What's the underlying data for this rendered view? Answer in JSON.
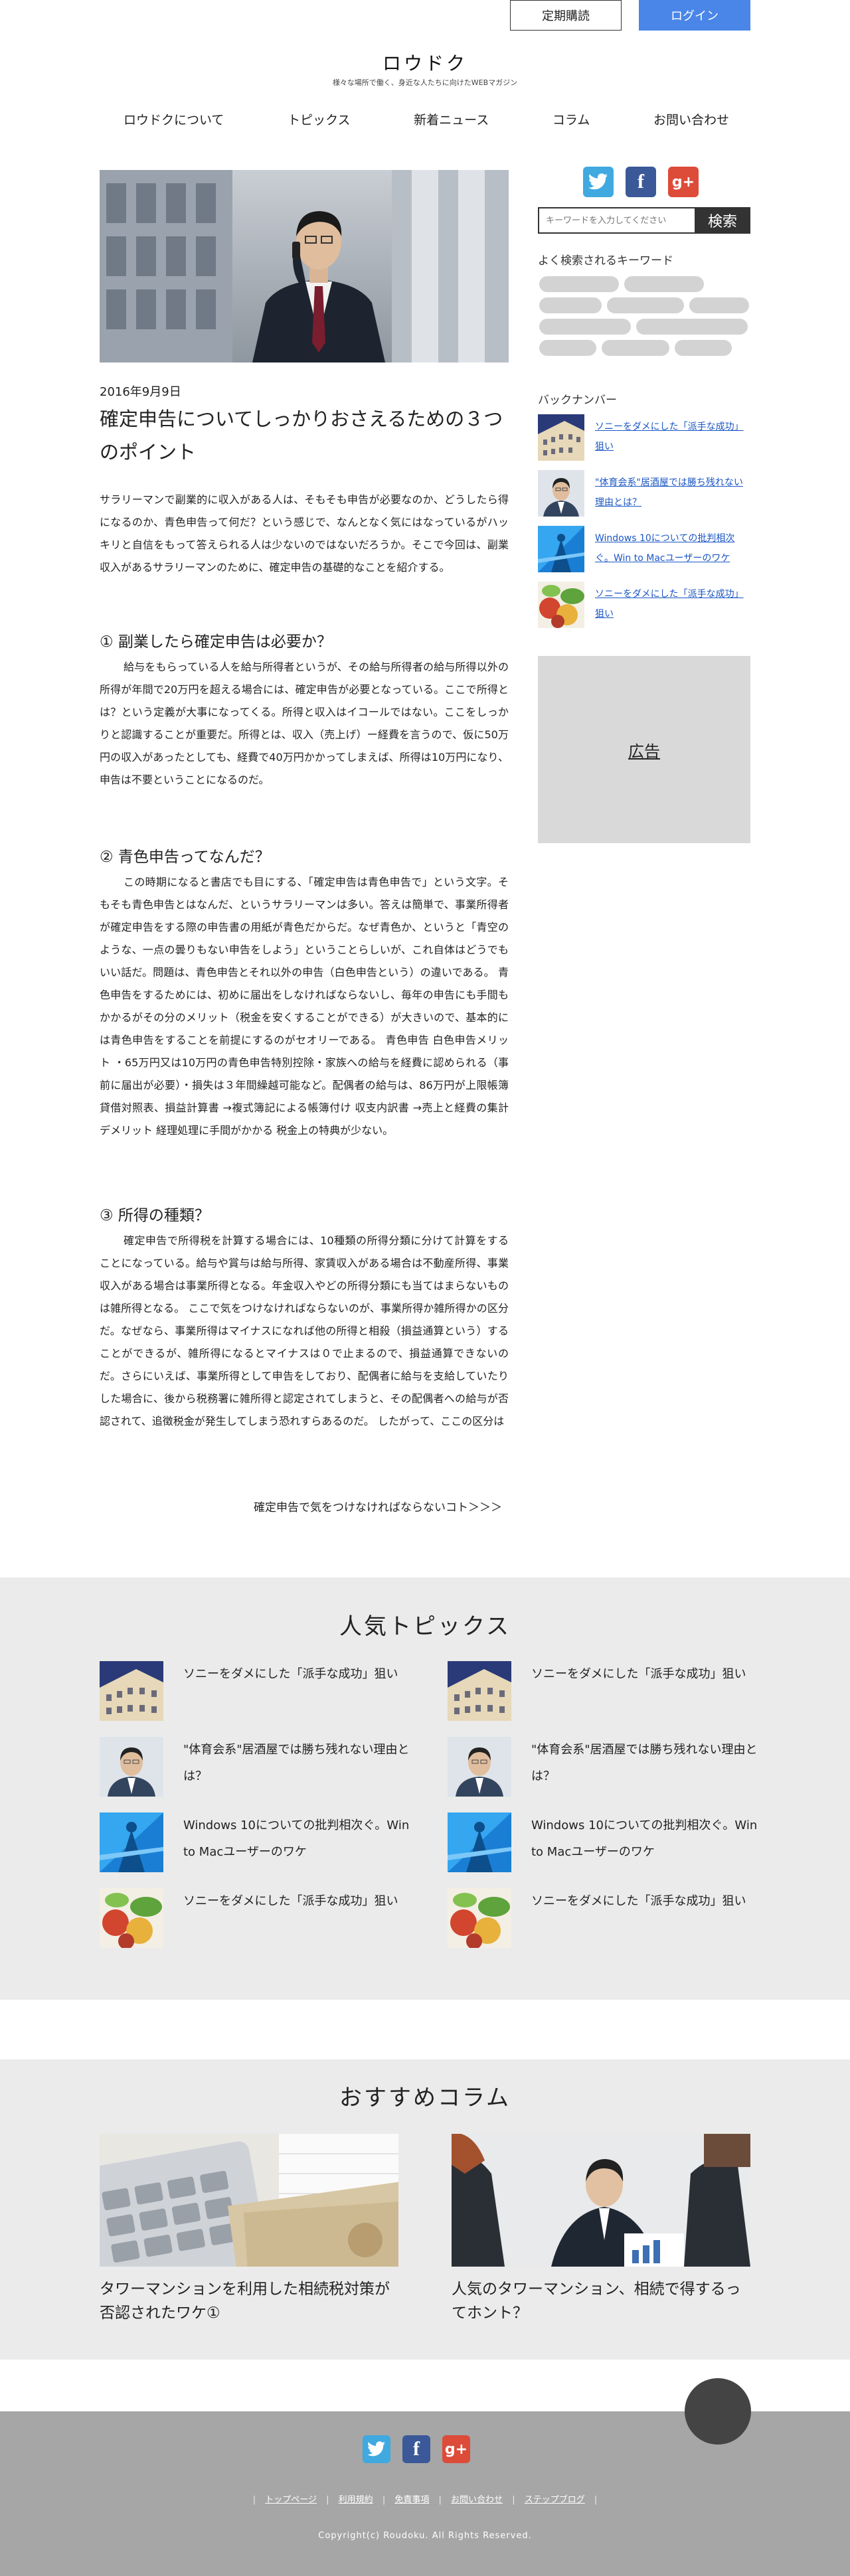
{
  "header": {
    "subscribe_label": "定期購読",
    "login_label": "ログイン",
    "site_title": "ロウドク",
    "site_subtitle": "様々な場所で働く、身近な人たちに向けたWEBマガジン",
    "nav": [
      "ロウドクについて",
      "トピックス",
      "新着ニュース",
      "コラム",
      "お問い合わせ"
    ]
  },
  "article": {
    "date": "2016年9月9日",
    "title": "確定申告についてしっかりおさえるための３つのポイント",
    "lead": "サラリーマンで副業的に収入がある人は、そもそも申告が必要なのか、どうしたら得になるのか、青色申告って何だ？という感じで、なんとなく気にはなっているがハッキリと自信をもって答えられる人は少ないのではないだろうか。そこで今回は、副業収入があるサラリーマンのために、確定申告の基礎的なことを紹介する。",
    "sections": [
      {
        "heading": "① 副業したら確定申告は必要か？",
        "body": "給与をもらっている人を給与所得者というが、その給与所得者の給与所得以外の所得が年間で20万円を超える場合には、確定申告が必要となっている。ここで所得とは？という定義が大事になってくる。所得と収入はイコールではない。ここをしっかりと認識することが重要だ。所得とは、収入（売上げ）ー経費を言うので、仮に50万円の収入があったとしても、経費で40万円かかってしまえば、所得は10万円になり、申告は不要ということになるのだ。"
      },
      {
        "heading": "② 青色申告ってなんだ？",
        "body": "この時期になると書店でも目にする、「確定申告は青色申告で」という文字。そもそも青色申告とはなんだ、というサラリーマンは多い。答えは簡単で、事業所得者が確定申告をする際の申告書の用紙が青色だからだ。なぜ青色か、というと「青空のような、一点の曇りもない申告をしよう」ということらしいが、これ自体はどうでもいい話だ。問題は、青色申告とそれ以外の申告（白色申告という）の違いである。 青色申告をするためには、初めに届出をしなければならないし、毎年の申告にも手間もかかるがその分のメリット（税金を安くすることができる）が大きいので、基本的には青色申告をすることを前提にするのがセオリーである。 青色申告 白色申告メリット ・65万円又は10万円の青色申告特別控除・家族への給与を経費に認められる（事前に届出が必要）・損失は３年間繰越可能など。配偶者の給与は、86万円が上限帳簿 貸借対照表、損益計算書 →複式簿記による帳簿付け 収支内訳書 →売上と経費の集計デメリット 経理処理に手間がかかる 税金上の特典が少ない。"
      },
      {
        "heading": "③ 所得の種類？",
        "body": "確定申告で所得税を計算する場合には、10種類の所得分類に分けて計算をすることになっている。給与や賞与は給与所得、家賃収入がある場合は不動産所得、事業収入がある場合は事業所得となる。年金収入やどの所得分類にも当てはまらないものは雑所得となる。 ここで気をつけなければならないのが、事業所得か雑所得かの区分だ。なぜなら、事業所得はマイナスになれば他の所得と相殺（損益通算という）することができるが、雑所得になるとマイナスは０で止まるので、損益通算できないのだ。さらにいえば、事業所得として申告をしており、配偶者に給与を支給していたりした場合に、後から税務署に雑所得と認定されてしまうと、その配偶者への給与が否認されて、追徴税金が発生してしまう恐れすらあるのだ。 したがって、ここの区分は"
      }
    ],
    "more_link": "確定申告で気をつけなければならないコト＞＞＞"
  },
  "sidebar": {
    "search": {
      "placeholder": "キーワードを入力してください",
      "button_label": "検索"
    },
    "keywords_heading": "よく検索されるキーワード",
    "backnumber_heading": "バックナンバー",
    "backnumbers": [
      {
        "title": "ソニーをダメにした「派手な成功」狙い",
        "thumb": "building"
      },
      {
        "title": "\"体育会系\"居酒屋では勝ち残れない理由とは？",
        "thumb": "man"
      },
      {
        "title": "Windows 10についての批判相次ぐ。Win to Macユーザーのワケ",
        "thumb": "blue"
      },
      {
        "title": "ソニーをダメにした「派手な成功」狙い",
        "thumb": "veg"
      }
    ],
    "ad_label": "広告"
  },
  "popular": {
    "heading": "人気トピックス",
    "left": [
      {
        "title": "ソニーをダメにした「派手な成功」狙い",
        "thumb": "building"
      },
      {
        "title": "\"体育会系\"居酒屋では勝ち残れない理由とは？",
        "thumb": "man"
      },
      {
        "title": "Windows 10についての批判相次ぐ。Win to Macユーザーのワケ",
        "thumb": "blue"
      },
      {
        "title": "ソニーをダメにした「派手な成功」狙い",
        "thumb": "veg"
      }
    ],
    "right": [
      {
        "title": "ソニーをダメにした「派手な成功」狙い",
        "thumb": "building"
      },
      {
        "title": "\"体育会系\"居酒屋では勝ち残れない理由とは？",
        "thumb": "man"
      },
      {
        "title": "Windows 10についての批判相次ぐ。Win to Macユーザーのワケ",
        "thumb": "blue"
      },
      {
        "title": "ソニーをダメにした「派手な成功」狙い",
        "thumb": "veg"
      }
    ]
  },
  "recommend": {
    "heading": "おすすめコラム",
    "cards": [
      {
        "title": "タワーマンションを利用した相続税対策が否認されたワケ①"
      },
      {
        "title": "人気のタワーマンション、相続で得するってホント？"
      }
    ]
  },
  "footer": {
    "links": [
      "トップページ",
      "利用規約",
      "免責事項",
      "お問い合わせ",
      "ステップブログ"
    ],
    "copyright": "Copyright(c) Roudoku. All Rights Reserved."
  },
  "social": {
    "twitter": "twitter-icon",
    "facebook": "facebook-icon",
    "googleplus": "google-plus-icon",
    "fb_glyph": "f",
    "gp_glyph": "g+"
  },
  "colors": {
    "accent": "#4a86e8",
    "gray_band": "#ebebeb",
    "footer": "#a6a6a6",
    "link": "#1a56c4"
  }
}
